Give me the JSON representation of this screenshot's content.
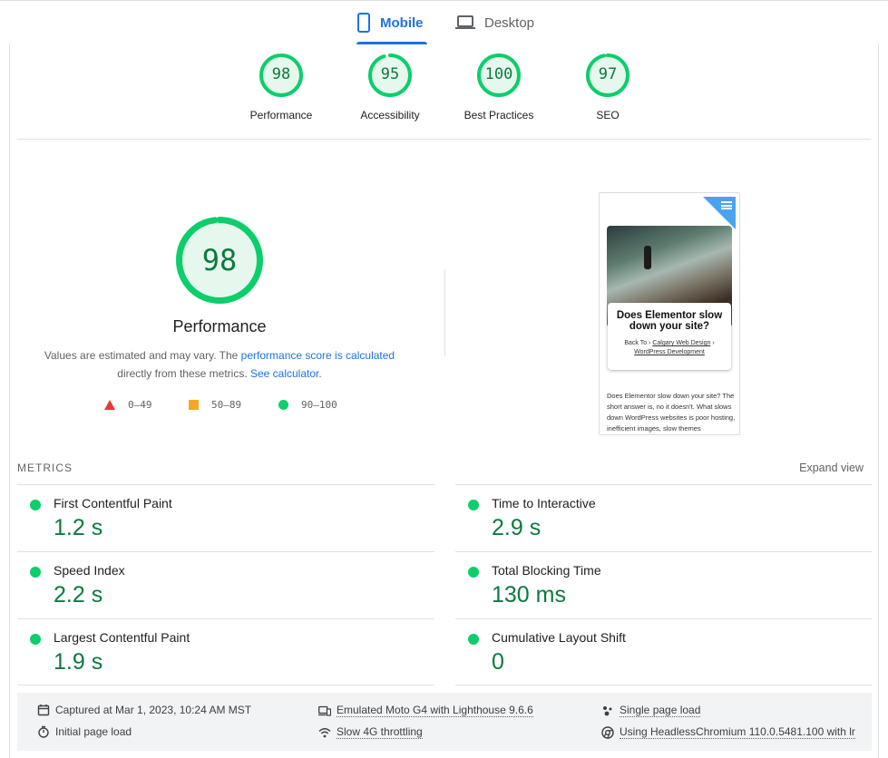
{
  "tabs": {
    "mobile": "Mobile",
    "desktop": "Desktop"
  },
  "scores": [
    {
      "value": "98",
      "label": "Performance",
      "fraction": 0.98
    },
    {
      "value": "95",
      "label": "Accessibility",
      "fraction": 0.95
    },
    {
      "value": "100",
      "label": "Best Practices",
      "fraction": 1.0
    },
    {
      "value": "97",
      "label": "SEO",
      "fraction": 0.97
    }
  ],
  "performance": {
    "score": "98",
    "fraction": 0.98,
    "title": "Performance",
    "desc_prefix": "Values are estimated and may vary. The ",
    "desc_link1": "performance score is calculated",
    "desc_middle": "directly from these metrics. ",
    "desc_link2": "See calculator",
    "desc_suffix": "."
  },
  "legend": {
    "poor": "0–49",
    "average": "50–89",
    "good": "90–100"
  },
  "thumbnail": {
    "card_title": "Does Elementor slow down your site?",
    "breadcrumb_prefix": "Back To › ",
    "breadcrumb_link1": "Calgary Web Design",
    "breadcrumb_sep": " ›",
    "breadcrumb_link2": "WordPress Development",
    "body_text": "Does Elementor slow down your site? The short answer is, no it doesn't. What slows down WordPress websites is poor hosting, inefficient images, slow themes"
  },
  "metrics": {
    "label": "METRICS",
    "expand": "Expand view",
    "items": [
      {
        "name": "First Contentful Paint",
        "value": "1.2 s"
      },
      {
        "name": "Time to Interactive",
        "value": "2.9 s"
      },
      {
        "name": "Speed Index",
        "value": "2.2 s"
      },
      {
        "name": "Total Blocking Time",
        "value": "130 ms"
      },
      {
        "name": "Largest Contentful Paint",
        "value": "1.9 s"
      },
      {
        "name": "Cumulative Layout Shift",
        "value": "0"
      }
    ]
  },
  "footer": {
    "captured": "Captured at Mar 1, 2023, 10:24 AM MST",
    "initial_load": "Initial page load",
    "emulated": "Emulated Moto G4 with Lighthouse 9.6.6",
    "throttling": "Slow 4G throttling",
    "single_load": "Single page load",
    "browser": "Using HeadlessChromium 110.0.5481.100 with lr"
  },
  "colors": {
    "accent": "#1a73e8",
    "good": "#0cce6b",
    "good_text": "#0b7a3d",
    "average": "#f5a623",
    "poor": "#e53935"
  }
}
